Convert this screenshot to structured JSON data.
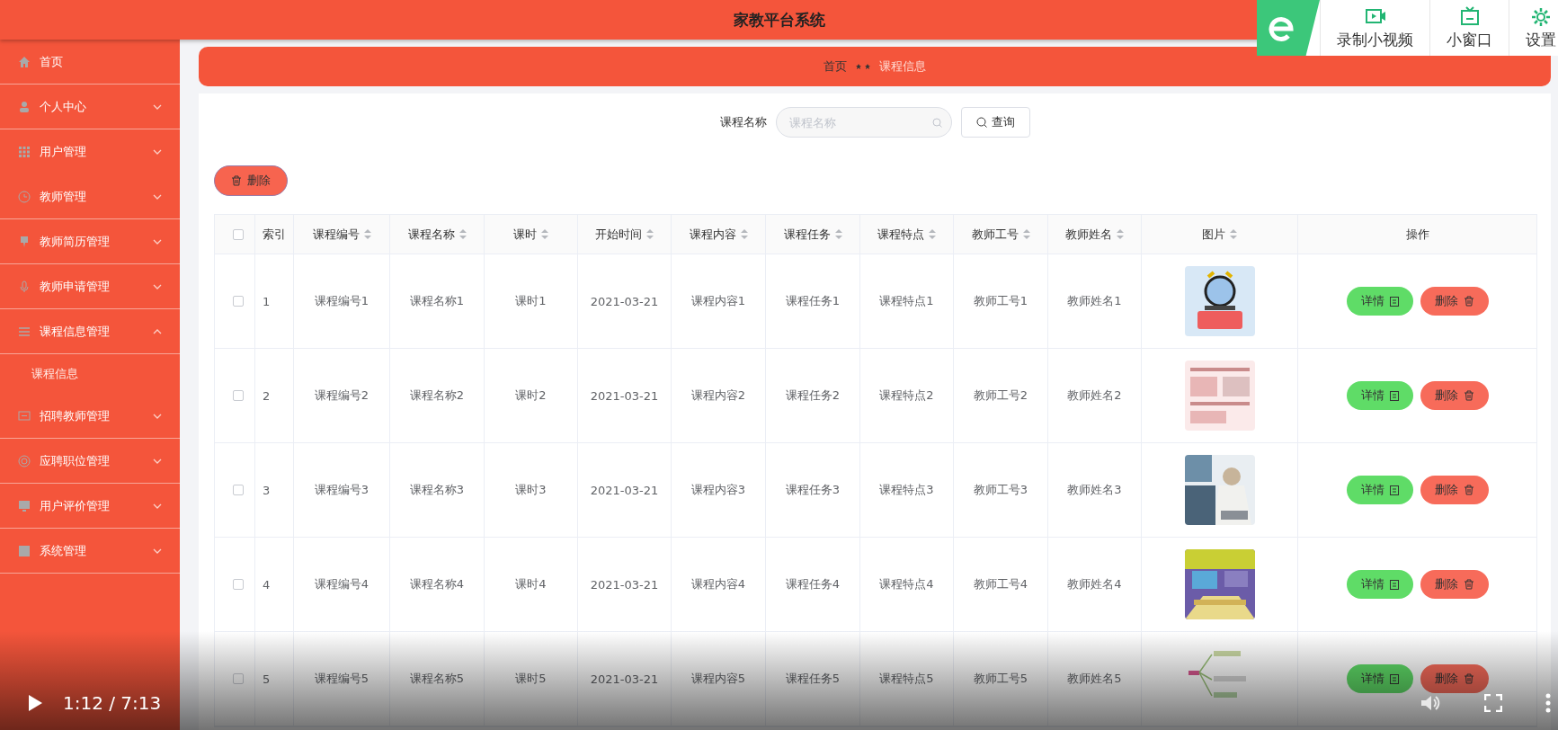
{
  "header": {
    "title": "家教平台系统"
  },
  "sidebar": {
    "items": [
      {
        "label": "首页",
        "kind": "link"
      },
      {
        "label": "个人中心",
        "kind": "menu",
        "expanded": false
      },
      {
        "label": "用户管理",
        "kind": "menu",
        "expanded": false
      },
      {
        "label": "教师管理",
        "kind": "menu",
        "expanded": false
      },
      {
        "label": "教师简历管理",
        "kind": "menu",
        "expanded": false
      },
      {
        "label": "教师申请管理",
        "kind": "menu",
        "expanded": false
      },
      {
        "label": "课程信息管理",
        "kind": "menu",
        "expanded": true,
        "children": [
          {
            "label": "课程信息",
            "selected": true
          }
        ]
      },
      {
        "label": "招聘教师管理",
        "kind": "menu",
        "expanded": false
      },
      {
        "label": "应聘职位管理",
        "kind": "menu",
        "expanded": false
      },
      {
        "label": "用户评价管理",
        "kind": "menu",
        "expanded": false
      },
      {
        "label": "系统管理",
        "kind": "menu",
        "expanded": false
      }
    ]
  },
  "breadcrumb": [
    "首页",
    "课程信息"
  ],
  "search": {
    "label": "课程名称",
    "placeholder": "课程名称",
    "button": "查询"
  },
  "delete_button": "删除",
  "table": {
    "header_checked": false,
    "columns": [
      {
        "label": "索引",
        "sortable": false
      },
      {
        "label": "课程编号",
        "sortable": true
      },
      {
        "label": "课程名称",
        "sortable": true
      },
      {
        "label": "课时",
        "sortable": true
      },
      {
        "label": "开始时间",
        "sortable": true
      },
      {
        "label": "课程内容",
        "sortable": true
      },
      {
        "label": "课程任务",
        "sortable": true
      },
      {
        "label": "课程特点",
        "sortable": true
      },
      {
        "label": "教师工号",
        "sortable": true
      },
      {
        "label": "教师姓名",
        "sortable": true
      },
      {
        "label": "图片",
        "sortable": true
      },
      {
        "label": "操作",
        "sortable": false
      }
    ],
    "rows": [
      {
        "checked": false,
        "cells": [
          "1",
          "课程编号1",
          "课程名称1",
          "课时1",
          "2021-03-21",
          "课程内容1",
          "课程任务1",
          "课程特点1",
          "教师工号1",
          "教师姓名1"
        ],
        "actions": [
          "详情",
          "删除"
        ]
      },
      {
        "checked": false,
        "cells": [
          "2",
          "课程编号2",
          "课程名称2",
          "课时2",
          "2021-03-21",
          "课程内容2",
          "课程任务2",
          "课程特点2",
          "教师工号2",
          "教师姓名2"
        ],
        "actions": [
          "详情",
          "删除"
        ]
      },
      {
        "checked": false,
        "cells": [
          "3",
          "课程编号3",
          "课程名称3",
          "课时3",
          "2021-03-21",
          "课程内容3",
          "课程任务3",
          "课程特点3",
          "教师工号3",
          "教师姓名3"
        ],
        "actions": [
          "详情",
          "删除"
        ]
      },
      {
        "checked": false,
        "cells": [
          "4",
          "课程编号4",
          "课程名称4",
          "课时4",
          "2021-03-21",
          "课程内容4",
          "课程任务4",
          "课程特点4",
          "教师工号4",
          "教师姓名4"
        ],
        "actions": [
          "详情",
          "删除"
        ]
      },
      {
        "checked": false,
        "cells": [
          "5",
          "课程编号5",
          "课程名称5",
          "课时5",
          "2021-03-21",
          "课程内容5",
          "课程任务5",
          "课程特点5",
          "教师工号5",
          "教师姓名5"
        ],
        "actions": [
          "详情",
          "删除"
        ]
      }
    ]
  },
  "player_toolbar": [
    {
      "label": "录制小视频"
    },
    {
      "label": "小窗口"
    },
    {
      "label": "设置"
    }
  ],
  "player": {
    "playing": false,
    "time": "1:12 / 7:13"
  }
}
